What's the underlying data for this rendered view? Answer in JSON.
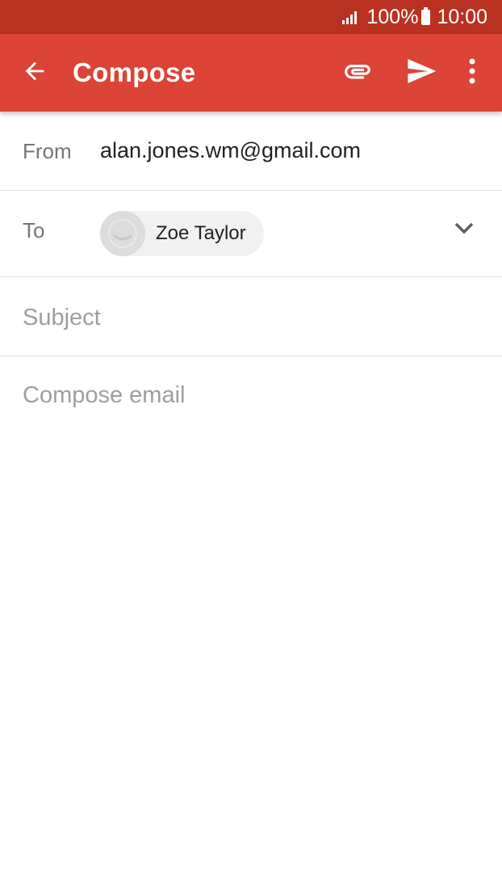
{
  "status_bar": {
    "battery": "100%",
    "time": "10:00"
  },
  "app_bar": {
    "title": "Compose",
    "back_icon": "arrow-back-icon",
    "attach_icon": "paperclip-icon",
    "send_icon": "send-icon",
    "more_icon": "more-vert-icon",
    "color": "#db4437",
    "status_color": "#b93221"
  },
  "compose": {
    "from_label": "From",
    "from_value": "alan.jones.wm@gmail.com",
    "to_label": "To",
    "to_chips": [
      {
        "name": "Zoe Taylor",
        "avatar_icon": "default-avatar-icon"
      }
    ],
    "expand_icon": "chevron-down-icon",
    "subject_placeholder": "Subject",
    "body_placeholder": "Compose email"
  }
}
